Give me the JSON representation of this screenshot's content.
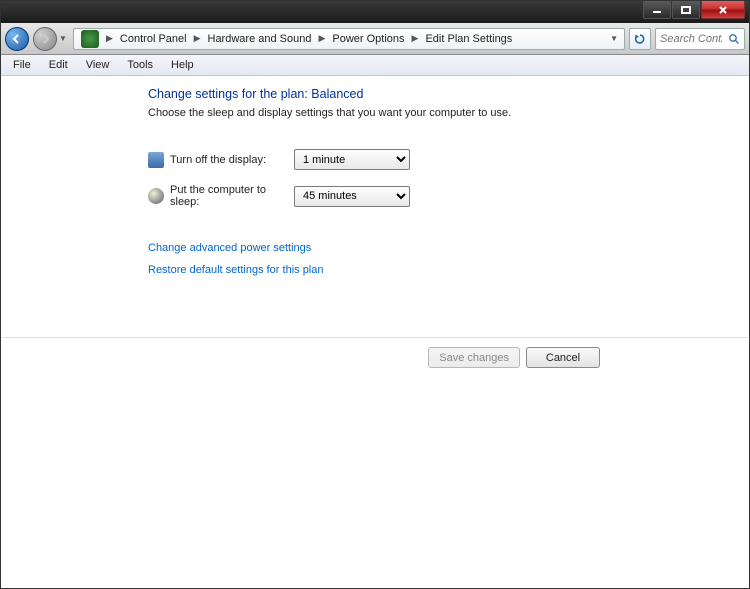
{
  "window_controls": {
    "minimize": "minimize",
    "maximize": "maximize",
    "close": "close"
  },
  "breadcrumb": {
    "items": [
      "Control Panel",
      "Hardware and Sound",
      "Power Options",
      "Edit Plan Settings"
    ]
  },
  "search": {
    "placeholder": "Search Control ..."
  },
  "menubar": {
    "items": [
      "File",
      "Edit",
      "View",
      "Tools",
      "Help"
    ]
  },
  "page": {
    "title": "Change settings for the plan: Balanced",
    "description": "Choose the sleep and display settings that you want your computer to use."
  },
  "settings": {
    "display_off": {
      "label": "Turn off the display:",
      "value": "1 minute"
    },
    "sleep": {
      "label": "Put the computer to sleep:",
      "value": "45 minutes"
    }
  },
  "links": {
    "advanced": "Change advanced power settings",
    "restore": "Restore default settings for this plan"
  },
  "buttons": {
    "save": "Save changes",
    "cancel": "Cancel"
  }
}
